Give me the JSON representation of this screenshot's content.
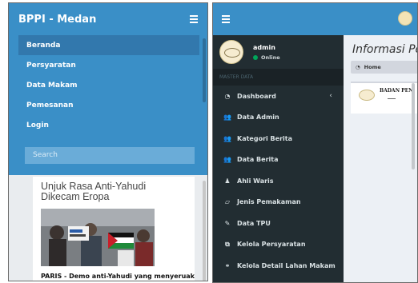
{
  "left": {
    "brand": "BPPI - Medan",
    "menu": [
      {
        "label": "Beranda",
        "active": true
      },
      {
        "label": "Persyaratan",
        "active": false
      },
      {
        "label": "Data Makam",
        "active": false
      },
      {
        "label": "Pemesanan",
        "active": false
      },
      {
        "label": "Login",
        "active": false
      }
    ],
    "search": {
      "placeholder": "Search"
    },
    "article": {
      "title": "Unjuk Rasa Anti-Yahudi Dikecam Eropa",
      "excerpt": "PARIS - Demo anti-Yahudi yang menyeruak"
    }
  },
  "right": {
    "user": {
      "name": "admin",
      "status": "Online"
    },
    "section_header": "MASTER DATA",
    "menu": [
      {
        "label": "Dashboard",
        "icon": "dashboard-icon",
        "glyph": "◔",
        "has_caret": true
      },
      {
        "label": "Data Admin",
        "icon": "users-icon",
        "glyph": "👥"
      },
      {
        "label": "Kategori Berita",
        "icon": "users-icon",
        "glyph": "👥"
      },
      {
        "label": "Data Berita",
        "icon": "users-icon",
        "glyph": "👥"
      },
      {
        "label": "Ahli Waris",
        "icon": "user-icon",
        "glyph": "♟"
      },
      {
        "label": "Jenis Pemakaman",
        "icon": "book-icon",
        "glyph": "▱"
      },
      {
        "label": "Data TPU",
        "icon": "edit-icon",
        "glyph": "✎"
      },
      {
        "label": "Kelola Persyaratan",
        "icon": "copy-icon",
        "glyph": "⧉"
      },
      {
        "label": "Kelola Detail Lahan Makam",
        "icon": "link-icon",
        "glyph": "⚭"
      }
    ],
    "page_title": "Informasi Pe",
    "breadcrumb": "Home",
    "box_text": "BADAN PEN"
  }
}
